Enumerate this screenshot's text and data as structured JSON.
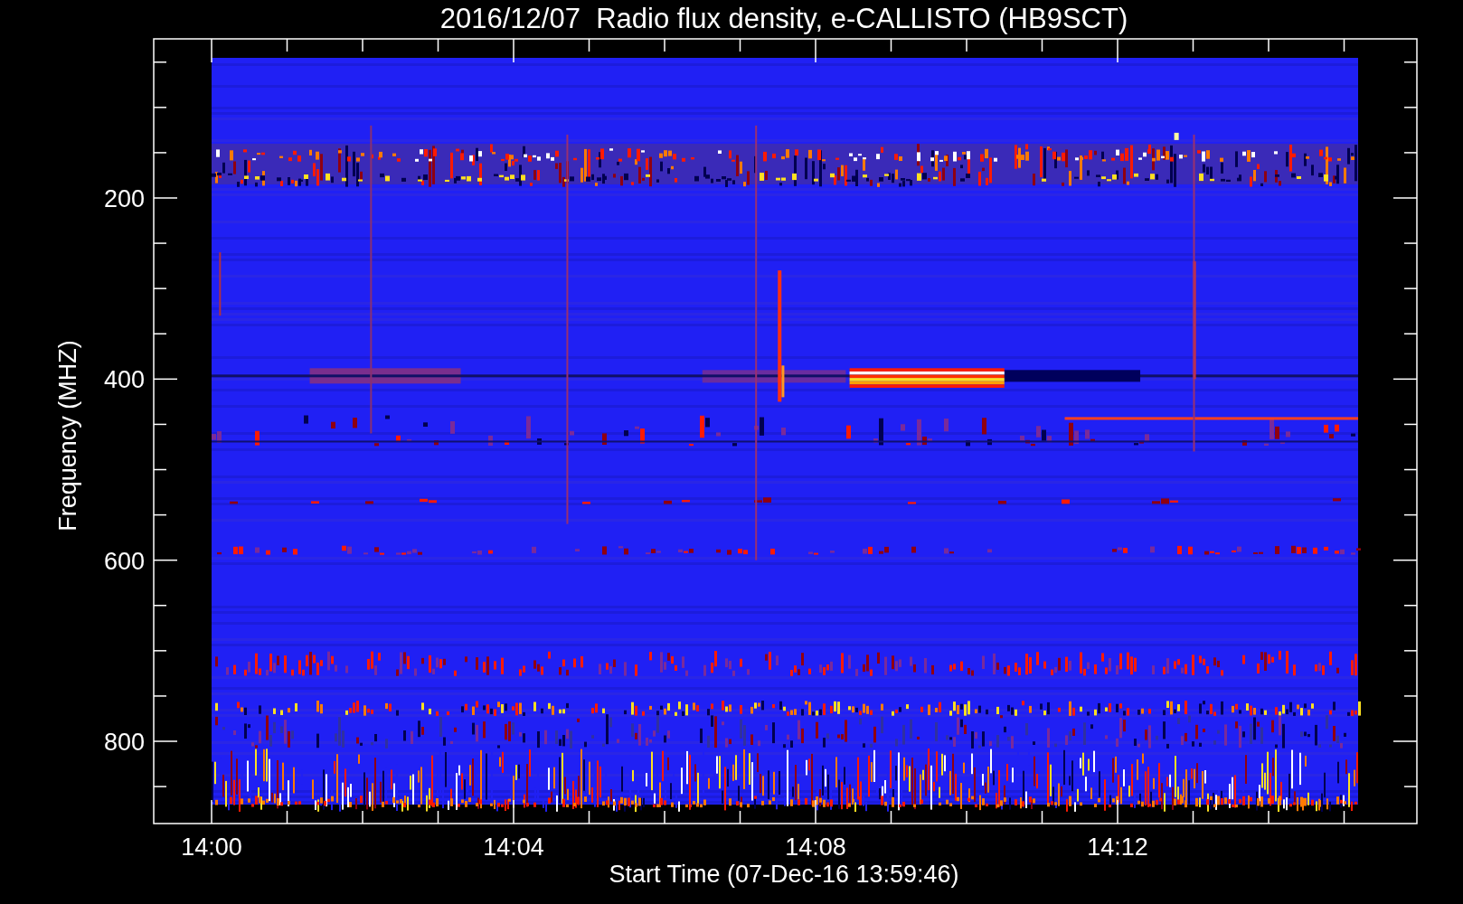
{
  "plot": {
    "title": "2016/12/07  Radio flux density, e-CALLISTO (HB9SCT)",
    "y_axis": {
      "label": "Frequency (MHZ)",
      "ticks": [
        "200",
        "400",
        "600",
        "800"
      ]
    },
    "x_axis": {
      "label": "Start Time (07-Dec-16 13:59:46)",
      "ticks": [
        "14:00",
        "14:04",
        "14:08",
        "14:12"
      ]
    }
  }
}
